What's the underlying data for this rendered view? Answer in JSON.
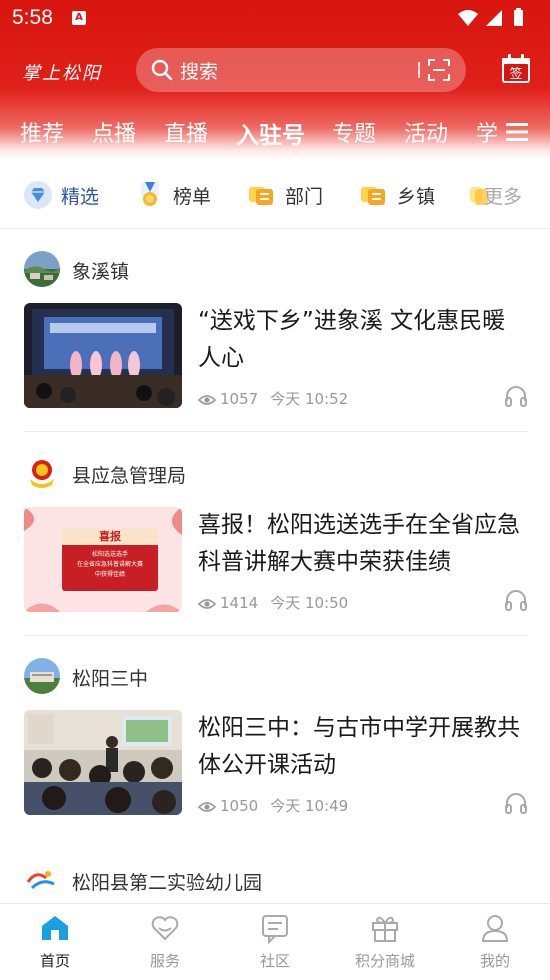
{
  "status_bar": {
    "time": "5:58",
    "notification_badge": "A"
  },
  "header": {
    "logo_text": "掌上松阳",
    "search": {
      "placeholder": "搜索"
    },
    "calendar_badge": "签"
  },
  "channels": [
    {
      "label": "推荐",
      "active": false
    },
    {
      "label": "点播",
      "active": false
    },
    {
      "label": "直播",
      "active": false
    },
    {
      "label": "入驻号",
      "active": true
    },
    {
      "label": "专题",
      "active": false
    },
    {
      "label": "活动",
      "active": false
    },
    {
      "label": "学",
      "active": false
    }
  ],
  "subnav": [
    {
      "label": "精选",
      "icon": "diamond-icon",
      "active": true
    },
    {
      "label": "榜单",
      "icon": "medal-icon",
      "active": false
    },
    {
      "label": "部门",
      "icon": "department-icon",
      "active": false
    },
    {
      "label": "乡镇",
      "icon": "township-icon",
      "active": false
    },
    {
      "label": "更多",
      "icon": "more-icon",
      "active": false
    }
  ],
  "feed": [
    {
      "source": "象溪镇",
      "title": "“送戏下乡”进象溪 文化惠民暖人心",
      "views": "1057",
      "time": "今天 10:52"
    },
    {
      "source": "县应急管理局",
      "title": "喜报！松阳选送选手在全省应急科普讲解大赛中荣获佳绩",
      "views": "1414",
      "time": "今天 10:50",
      "thumb_text": {
        "heading": "喜报",
        "line1": "松阳选送选手",
        "line2": "在全省应急科普讲解大赛",
        "line3": "中获得佳绩"
      }
    },
    {
      "source": "松阳三中",
      "title": "松阳三中：与古市中学开展教共体公开课活动",
      "views": "1050",
      "time": "今天 10:49"
    },
    {
      "source": "松阳县第二实验幼儿园"
    }
  ],
  "bottom_tabs": [
    {
      "label": "首页",
      "icon": "home-icon",
      "active": true
    },
    {
      "label": "服务",
      "icon": "heart-icon",
      "active": false
    },
    {
      "label": "社区",
      "icon": "community-icon",
      "active": false
    },
    {
      "label": "积分商城",
      "icon": "gift-icon",
      "active": false
    },
    {
      "label": "我的",
      "icon": "profile-icon",
      "active": false
    }
  ],
  "colors": {
    "brand_red": "#d8150f",
    "active_blue": "#2f56a8",
    "tab_active": "#1aa0e0"
  }
}
